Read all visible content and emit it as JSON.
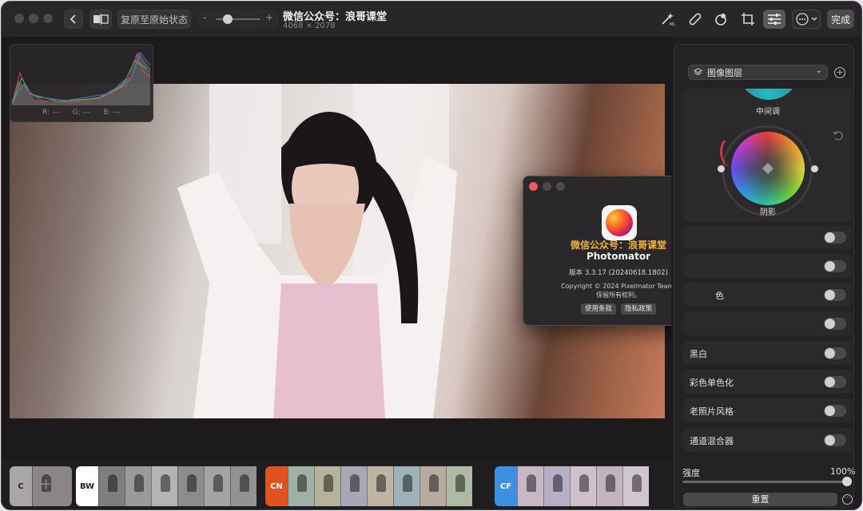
{
  "toolbar": {
    "restore_label": "复原至原始状态",
    "zoom_minus": "-",
    "zoom_plus": "+",
    "title": "微信公众号：浪哥课堂",
    "dimensions": "4068 × 2078",
    "done_label": "完成",
    "icons": [
      "chevron-left-icon",
      "compare-icon",
      "ml-magic-icon",
      "bandage-icon",
      "selective-color-icon",
      "crop-icon",
      "adjust-sliders-icon",
      "more-icon"
    ]
  },
  "histogram": {
    "r_label": "R: ---",
    "g_label": "G: ---",
    "b_label": "B: ---"
  },
  "about": {
    "watermark": "微信公众号：浪哥课堂",
    "app_name": "Photomator",
    "version": "版本 3.3.17 (20240618.1802)",
    "copyright_line1": "Copyright © 2024 Pixelmator Team.",
    "copyright_line2": "保留所有权利。",
    "terms_label": "使用条款",
    "privacy_label": "隐私政策"
  },
  "filmstrip": {
    "groups": [
      {
        "tag": "C",
        "color": "#a8a6a8"
      },
      {
        "tag": "BW",
        "color": "#ffffff"
      },
      {
        "tag": "CN",
        "color": "#e0531f"
      },
      {
        "tag": "CF",
        "color": "#3d8fe0"
      }
    ],
    "add_symbol": "+"
  },
  "panel": {
    "layer_label": "图像图层",
    "midtones_label": "中间调",
    "shadows_label": "阴影",
    "rows_partial": [
      "",
      "",
      "色",
      ""
    ],
    "rows": [
      {
        "label": "黑白"
      },
      {
        "label": "彩色单色化"
      },
      {
        "label": "老照片风格"
      },
      {
        "label": "通道混合器"
      }
    ],
    "strength_label": "强度",
    "strength_value": "100%",
    "reset_label": "重置"
  }
}
